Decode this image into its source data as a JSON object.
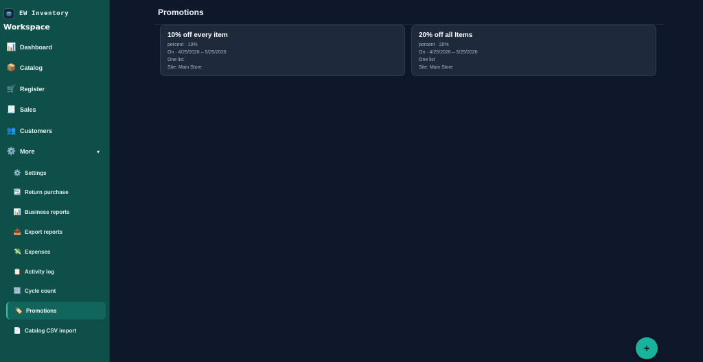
{
  "brand": {
    "name": "EW Inventory",
    "workspace": "Workspace",
    "logo_icon": "box-icon"
  },
  "nav": {
    "items": [
      {
        "label": "Dashboard",
        "icon": "📊"
      },
      {
        "label": "Catalog",
        "icon": "📦"
      },
      {
        "label": "Register",
        "icon": "🛒"
      },
      {
        "label": "Sales",
        "icon": "🧾"
      },
      {
        "label": "Customers",
        "icon": "👥"
      },
      {
        "label": "More",
        "icon": "⚙️",
        "caret": "▾"
      }
    ],
    "sub_items": [
      {
        "label": "Settings",
        "icon": "⚙️"
      },
      {
        "label": "Return purchase",
        "icon": "↩️"
      },
      {
        "label": "Business reports",
        "icon": "📊"
      },
      {
        "label": "Export reports",
        "icon": "📤"
      },
      {
        "label": "Expenses",
        "icon": "💸"
      },
      {
        "label": "Activity log",
        "icon": "📋"
      },
      {
        "label": "Cycle count",
        "icon": "🔢"
      },
      {
        "label": "Promotions",
        "icon": "🏷️",
        "active": true
      },
      {
        "label": "Catalog CSV import",
        "icon": "📄"
      }
    ]
  },
  "page": {
    "title": "Promotions"
  },
  "promotions": [
    {
      "title": "10% off every item",
      "type_line": "percent · 10%",
      "date_line": "On · 4/25/2026 – 5/25/2026",
      "scope_line": "One list",
      "site_line": "Site: Main Store"
    },
    {
      "title": "20% off all Items",
      "type_line": "percent · 20%",
      "date_line": "On · 4/25/2026 – 5/25/2026",
      "scope_line": "One list",
      "site_line": "Site: Main Store"
    }
  ],
  "fab": {
    "label": "+"
  },
  "colors": {
    "sidebar": "#0f4f4a",
    "background": "#0f172a",
    "card": "#1e293b",
    "accent": "#17b39a"
  }
}
